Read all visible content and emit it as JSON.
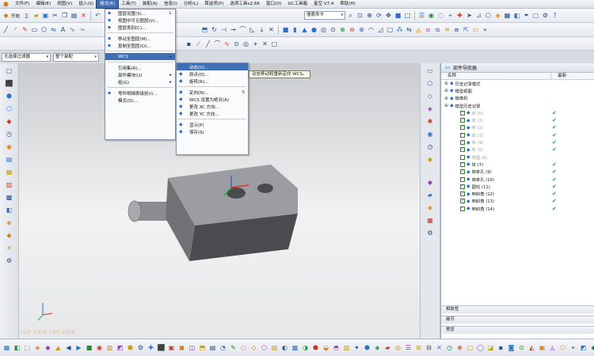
{
  "menubar": {
    "items": [
      "文件(F)",
      "编辑(E)",
      "视图(V)",
      "插入(S)",
      "格式(R)",
      "工具(T)",
      "装配(A)",
      "信息(I)",
      "分析(L)",
      "首选项(P)",
      "选项工具v2.66",
      "窗口(O)",
      "GC工具箱",
      "星空 V7.4",
      "帮助(H)"
    ],
    "active_index": 4
  },
  "toolbar1": {
    "start_label": "开始",
    "search_placeholder": "搜索命令"
  },
  "filter_row": {
    "selection_filter": "无选择过滤器",
    "assembly_scope": "整个装配"
  },
  "format_menu": {
    "items": [
      {
        "label": "图层设置(S)...",
        "shortcut": "L",
        "icon": "layer-settings-icon"
      },
      {
        "label": "视图中可见图层(V)...",
        "shortcut": "",
        "icon": "visible-layers-icon"
      },
      {
        "label": "图层类别(C)...",
        "shortcut": "",
        "icon": "layer-category-icon"
      },
      {
        "label": "移动至图层(M)...",
        "shortcut": "",
        "icon": "move-layer-icon"
      },
      {
        "label": "复制至图层(O)...",
        "shortcut": "",
        "icon": "copy-layer-icon"
      },
      {
        "label": "WCS",
        "shortcut": "",
        "icon": "wcs-icon",
        "submenu": true
      },
      {
        "label": "引用集(R)...",
        "shortcut": "",
        "icon": ""
      },
      {
        "label": "部件模块(U)",
        "shortcut": "",
        "icon": "",
        "submenu": true
      },
      {
        "label": "组(G)",
        "shortcut": "",
        "icon": "",
        "submenu": true
      },
      {
        "label": "零件明细表级别(I)...",
        "shortcut": "",
        "icon": "part-list-icon"
      },
      {
        "label": "模式(D)...",
        "shortcut": "",
        "icon": ""
      }
    ]
  },
  "wcs_submenu": {
    "items": [
      {
        "label": "动态(D)...",
        "shortcut": "",
        "icon": "dynamic-wcs-icon"
      },
      {
        "label": "原点(O)...",
        "shortcut": "",
        "icon": "origin-icon"
      },
      {
        "label": "旋转(R)...",
        "shortcut": "",
        "icon": "rotate-icon"
      },
      {
        "label": "定向(N)...",
        "shortcut": "S",
        "icon": "orient-icon"
      },
      {
        "label": "WCS 设置为绝对(A)",
        "shortcut": "",
        "icon": "absolute-wcs-icon"
      },
      {
        "label": "更改 XC 方向...",
        "shortcut": "",
        "icon": "xc-direction-icon"
      },
      {
        "label": "更改 YC 方向...",
        "shortcut": "",
        "icon": "yc-direction-icon"
      },
      {
        "label": "显示(P)",
        "shortcut": "",
        "icon": "display-icon"
      },
      {
        "label": "保存(S)",
        "shortcut": "",
        "icon": "save-icon"
      }
    ]
  },
  "tooltip": "动态移动和重新定向 WCS。",
  "navigator": {
    "title": "部件导航器",
    "col_name": "名称",
    "col_latest": "最新",
    "items": [
      {
        "name": "历史记录模式",
        "icon": "history-icon",
        "checked": false,
        "latest": false,
        "dim": false
      },
      {
        "name": "模型视图",
        "icon": "model-views-icon",
        "checked": false,
        "latest": false,
        "dim": false
      },
      {
        "name": "摄像机",
        "icon": "camera-icon",
        "checked": false,
        "latest": false,
        "dim": false
      },
      {
        "name": "模型历史记录",
        "icon": "model-history-icon",
        "checked": false,
        "latest": false,
        "dim": false
      },
      {
        "name": "体 (0)",
        "icon": "body-icon",
        "checked": true,
        "latest": true,
        "dim": true
      },
      {
        "name": "体 (1)",
        "icon": "body-icon",
        "checked": true,
        "latest": true,
        "dim": true
      },
      {
        "name": "体 (2)",
        "icon": "body-icon",
        "checked": true,
        "latest": true,
        "dim": true
      },
      {
        "name": "体 (3)",
        "icon": "body-icon",
        "checked": true,
        "latest": true,
        "dim": true
      },
      {
        "name": "体 (4)",
        "icon": "body-icon",
        "checked": true,
        "latest": true,
        "dim": true
      },
      {
        "name": "体 (5)",
        "icon": "body-icon",
        "checked": true,
        "latest": true,
        "dim": true
      },
      {
        "name": "草图 (6)",
        "icon": "sketch-icon",
        "checked": false,
        "latest": false,
        "dim": true
      },
      {
        "name": "体 (7)",
        "icon": "body-icon",
        "checked": true,
        "latest": true,
        "dim": false
      },
      {
        "name": "简单孔 (9)",
        "icon": "hole-icon",
        "checked": true,
        "latest": true,
        "dim": false
      },
      {
        "name": "简单孔 (10)",
        "icon": "hole-icon",
        "checked": true,
        "latest": true,
        "dim": false
      },
      {
        "name": "圆柱 (11)",
        "icon": "cylinder-icon",
        "checked": true,
        "latest": true,
        "dim": false
      },
      {
        "name": "倒斜角 (12)",
        "icon": "chamfer-icon",
        "checked": true,
        "latest": true,
        "dim": false
      },
      {
        "name": "倒斜角 (13)",
        "icon": "chamfer-icon",
        "checked": true,
        "latest": true,
        "dim": false
      },
      {
        "name": "倒斜角 (14)",
        "icon": "chamfer-icon",
        "checked": true,
        "latest": true,
        "dim": false
      }
    ],
    "footer": [
      "相依性",
      "细节",
      "预览"
    ]
  },
  "viewport": {
    "view_label": "TOP VIEW  TOP VIEW"
  }
}
